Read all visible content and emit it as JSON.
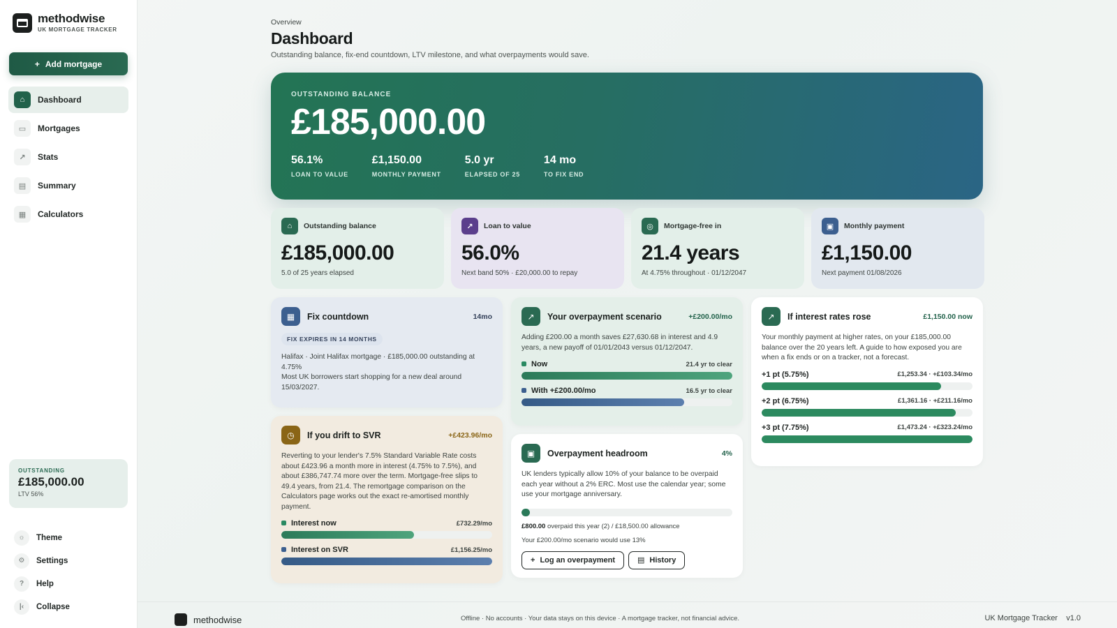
{
  "brand": {
    "name": "methodwise",
    "sub": "UK MORTGAGE TRACKER"
  },
  "sidebar": {
    "add_label": "Add mortgage",
    "items": [
      {
        "label": "Dashboard",
        "icon": "home-icon"
      },
      {
        "label": "Mortgages",
        "icon": "card-icon"
      },
      {
        "label": "Stats",
        "icon": "trend-icon"
      },
      {
        "label": "Summary",
        "icon": "document-icon"
      },
      {
        "label": "Calculators",
        "icon": "calculator-icon"
      }
    ],
    "outstanding": {
      "label": "OUTSTANDING",
      "value": "£185,000.00",
      "ltv": "LTV 56%"
    },
    "bottom": [
      {
        "label": "Theme",
        "icon": "sun-icon"
      },
      {
        "label": "Settings",
        "icon": "gear-icon"
      },
      {
        "label": "Help",
        "icon": "help-icon"
      },
      {
        "label": "Collapse",
        "icon": "collapse-icon"
      }
    ]
  },
  "header": {
    "crumb": "Overview",
    "title": "Dashboard",
    "subtitle": "Outstanding balance, fix-end countdown, LTV milestone, and what overpayments would save."
  },
  "hero": {
    "label": "OUTSTANDING BALANCE",
    "value": "£185,000.00",
    "stats": [
      {
        "value": "56.1%",
        "label": "LOAN TO VALUE"
      },
      {
        "value": "£1,150.00",
        "label": "MONTHLY PAYMENT"
      },
      {
        "value": "5.0 yr",
        "label": "ELAPSED OF 25"
      },
      {
        "value": "14 mo",
        "label": "TO FIX END"
      }
    ]
  },
  "kpis": [
    {
      "title": "Outstanding balance",
      "value": "£185,000.00",
      "note": "5.0 of 25 years elapsed"
    },
    {
      "title": "Loan to value",
      "value": "56.0%",
      "note": "Next band 50% · £20,000.00 to repay"
    },
    {
      "title": "Mortgage-free in",
      "value": "21.4 years",
      "note": "At 4.75% throughout · 01/12/2047"
    },
    {
      "title": "Monthly payment",
      "value": "£1,150.00",
      "note": "Next payment 01/08/2026"
    }
  ],
  "fix": {
    "title": "Fix countdown",
    "badge": "14mo",
    "pill": "FIX EXPIRES IN 14 MONTHS",
    "text": "Halifax · Joint Halifax mortgage · £185,000.00 outstanding at 4.75%\nMost UK borrowers start shopping for a new deal around 15/03/2027."
  },
  "svr": {
    "title": "If you drift to SVR",
    "badge": "+£423.96/mo",
    "text": "Reverting to your lender's 7.5% Standard Variable Rate costs about £423.96 a month more in interest (4.75% to 7.5%), and about £386,747.74 more over the term. Mortgage-free slips to 49.4 years, from 21.4. The remortgage comparison on the Calculators page works out the exact re-amortised monthly payment.",
    "rows": [
      {
        "label": "Interest now",
        "value": "£732.29/mo",
        "pct": 63
      },
      {
        "label": "Interest on SVR",
        "value": "£1,156.25/mo",
        "pct": 100
      }
    ]
  },
  "overpay": {
    "title": "Your overpayment scenario",
    "badge": "+£200.00/mo",
    "text": "Adding £200.00 a month saves £27,630.68 in interest and 4.9 years, a new payoff of 01/01/2043 versus 01/12/2047.",
    "rows": [
      {
        "label": "Now",
        "value": "21.4 yr to clear",
        "pct": 100
      },
      {
        "label": "With +£200.00/mo",
        "value": "16.5 yr to clear",
        "pct": 77
      }
    ]
  },
  "headroom": {
    "title": "Overpayment headroom",
    "badge": "4%",
    "text": "UK lenders typically allow 10% of your balance to be overpaid each year without a 2% ERC. Most use the calendar year; some use your mortgage anniversary.",
    "pct": 4,
    "amount": "£800.00",
    "amount_rest": "overpaid this year (2) / £18,500.00 allowance",
    "scenario": "Your £200.00/mo scenario would use 13%",
    "log_label": "Log an overpayment",
    "history_label": "History"
  },
  "rates": {
    "title": "If interest rates rose",
    "badge": "£1,150.00 now",
    "text": "Your monthly payment at higher rates, on your £185,000.00 balance over the 20 years left. A guide to how exposed you are when a fix ends or on a tracker, not a forecast.",
    "rows": [
      {
        "label": "+1 pt (5.75%)",
        "value": "£1,253.34 · +£103.34/mo",
        "pct": 85
      },
      {
        "label": "+2 pt (6.75%)",
        "value": "£1,361.16 · +£211.16/mo",
        "pct": 92
      },
      {
        "label": "+3 pt (7.75%)",
        "value": "£1,473.24 · +£323.24/mo",
        "pct": 100
      }
    ]
  },
  "footer": {
    "brand": "methodwise",
    "mid": "Offline · No accounts · Your data stays on this device · A mortgage tracker, not financial advice.",
    "right": "UK Mortgage Tracker    v1.0"
  },
  "colors": {
    "accent": "#22624b",
    "blue": "#3c5f8f"
  }
}
